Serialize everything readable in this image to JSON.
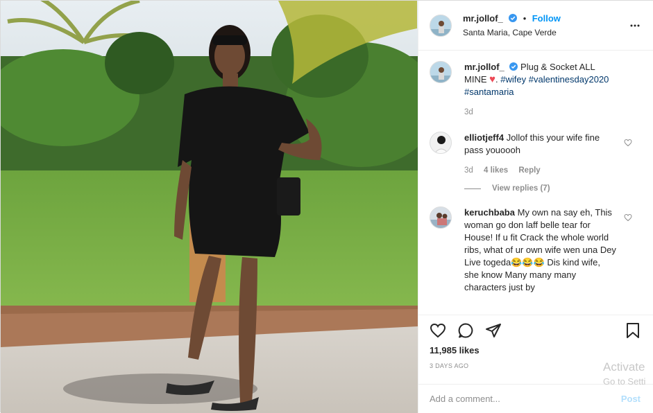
{
  "post": {
    "username": "mr.jollof_",
    "follow_label": "Follow",
    "dot": "•",
    "location": "Santa Maria, Cape Verde"
  },
  "caption": {
    "username": "mr.jollof_",
    "text": "Plug & Socket ALL MINE",
    "heart": "♥",
    "tail": ". ",
    "hashtags": [
      "#wifey",
      "#valentinesday2020",
      "#santamaria"
    ],
    "age": "3d"
  },
  "comments": [
    {
      "username": "elliotjeff4",
      "text": "Jollof this your wife fine pass youoooh",
      "age": "3d",
      "likes": "4 likes",
      "reply_label": "Reply",
      "view_replies": "View replies (7)"
    },
    {
      "username": "keruchbaba",
      "text": "My own na say eh, This woman go don laff belle tear for House! If u fit Crack the whole world ribs, what of ur own wife wen una Dey Live togeda😂😂😂 Dis kind wife, she know Many many many characters just by"
    }
  ],
  "stats": {
    "likes": "11,985 likes",
    "time_ago": "3 DAYS AGO"
  },
  "composer": {
    "placeholder": "Add a comment...",
    "post_label": "Post"
  },
  "watermark": {
    "line1": "Activate",
    "line2": "Go to Setti"
  },
  "icons": [
    "verified-badge-icon",
    "more-options-icon",
    "heart-icon",
    "comment-icon",
    "share-icon",
    "bookmark-icon",
    "like-comment-heart-icon"
  ],
  "colors": {
    "link": "#0095f6",
    "tag": "#00376b",
    "heart": "#ed4956",
    "muted": "#8e8e8e"
  }
}
